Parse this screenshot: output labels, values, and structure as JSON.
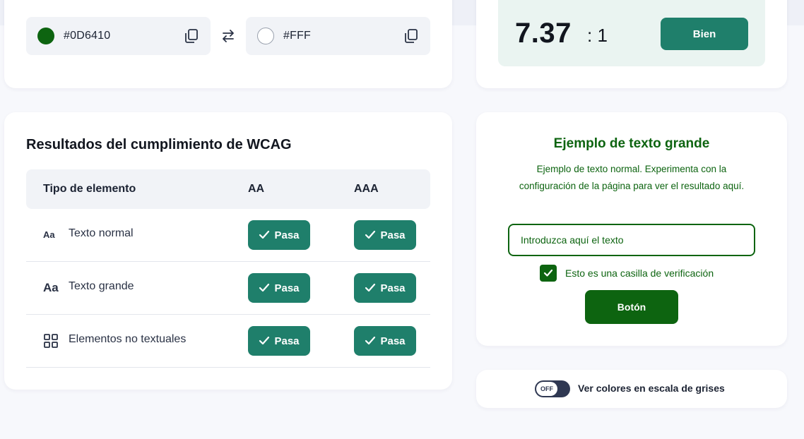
{
  "colors": {
    "foreground": "#0D6410",
    "background": "#FFF",
    "accent": "#1f7f6b",
    "example_text": "#0d6410"
  },
  "color_inputs": {
    "foreground_hex": "#0D6410",
    "background_hex": "#FFF"
  },
  "contrast": {
    "ratio": "7.37",
    "suffix": ": 1",
    "rating": "Bien"
  },
  "wcag": {
    "title": "Resultados del cumplimiento de WCAG",
    "headers": {
      "type": "Tipo de elemento",
      "aa": "AA",
      "aaa": "AAA"
    },
    "rows": [
      {
        "icon": "Aa",
        "label": "Texto normal",
        "aa": "Pasa",
        "aaa": "Pasa"
      },
      {
        "icon": "Aa",
        "label": "Texto grande",
        "aa": "Pasa",
        "aaa": "Pasa"
      },
      {
        "icon": "grid-icon",
        "label": "Elementos no textuales",
        "aa": "Pasa",
        "aaa": "Pasa"
      }
    ]
  },
  "example": {
    "title": "Ejemplo de texto grande",
    "body": "Ejemplo de texto normal. Experimenta con la configuración de la página para ver el resultado aquí.",
    "input_placeholder": "Introduzca aquí el texto",
    "checkbox_label": "Esto es una casilla de verificación",
    "button_label": "Botón"
  },
  "grayscale": {
    "toggle_state": "OFF",
    "label": "Ver colores en escala de grises"
  }
}
